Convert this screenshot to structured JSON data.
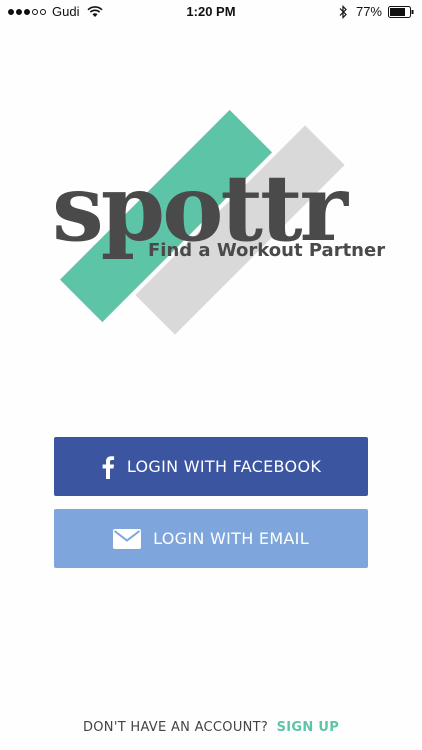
{
  "status_bar": {
    "carrier": "Gudi",
    "time": "1:20 PM",
    "battery": "77%"
  },
  "logo": {
    "wordmark": "spottr",
    "tagline": "Find a Workout Partner",
    "colors": {
      "green": "#5ec4a8",
      "gray": "#d9d9d9",
      "text": "#4a4a4a"
    }
  },
  "buttons": {
    "facebook_label": "LOGIN WITH FACEBOOK",
    "facebook_icon": "facebook-icon",
    "facebook_color": "#3b55a0",
    "email_label": "LOGIN WITH EMAIL",
    "email_icon": "mail-icon",
    "email_color": "#7fa6dc"
  },
  "footer": {
    "prompt": "DON'T HAVE AN ACCOUNT?",
    "signup_label": "SIGN UP"
  }
}
